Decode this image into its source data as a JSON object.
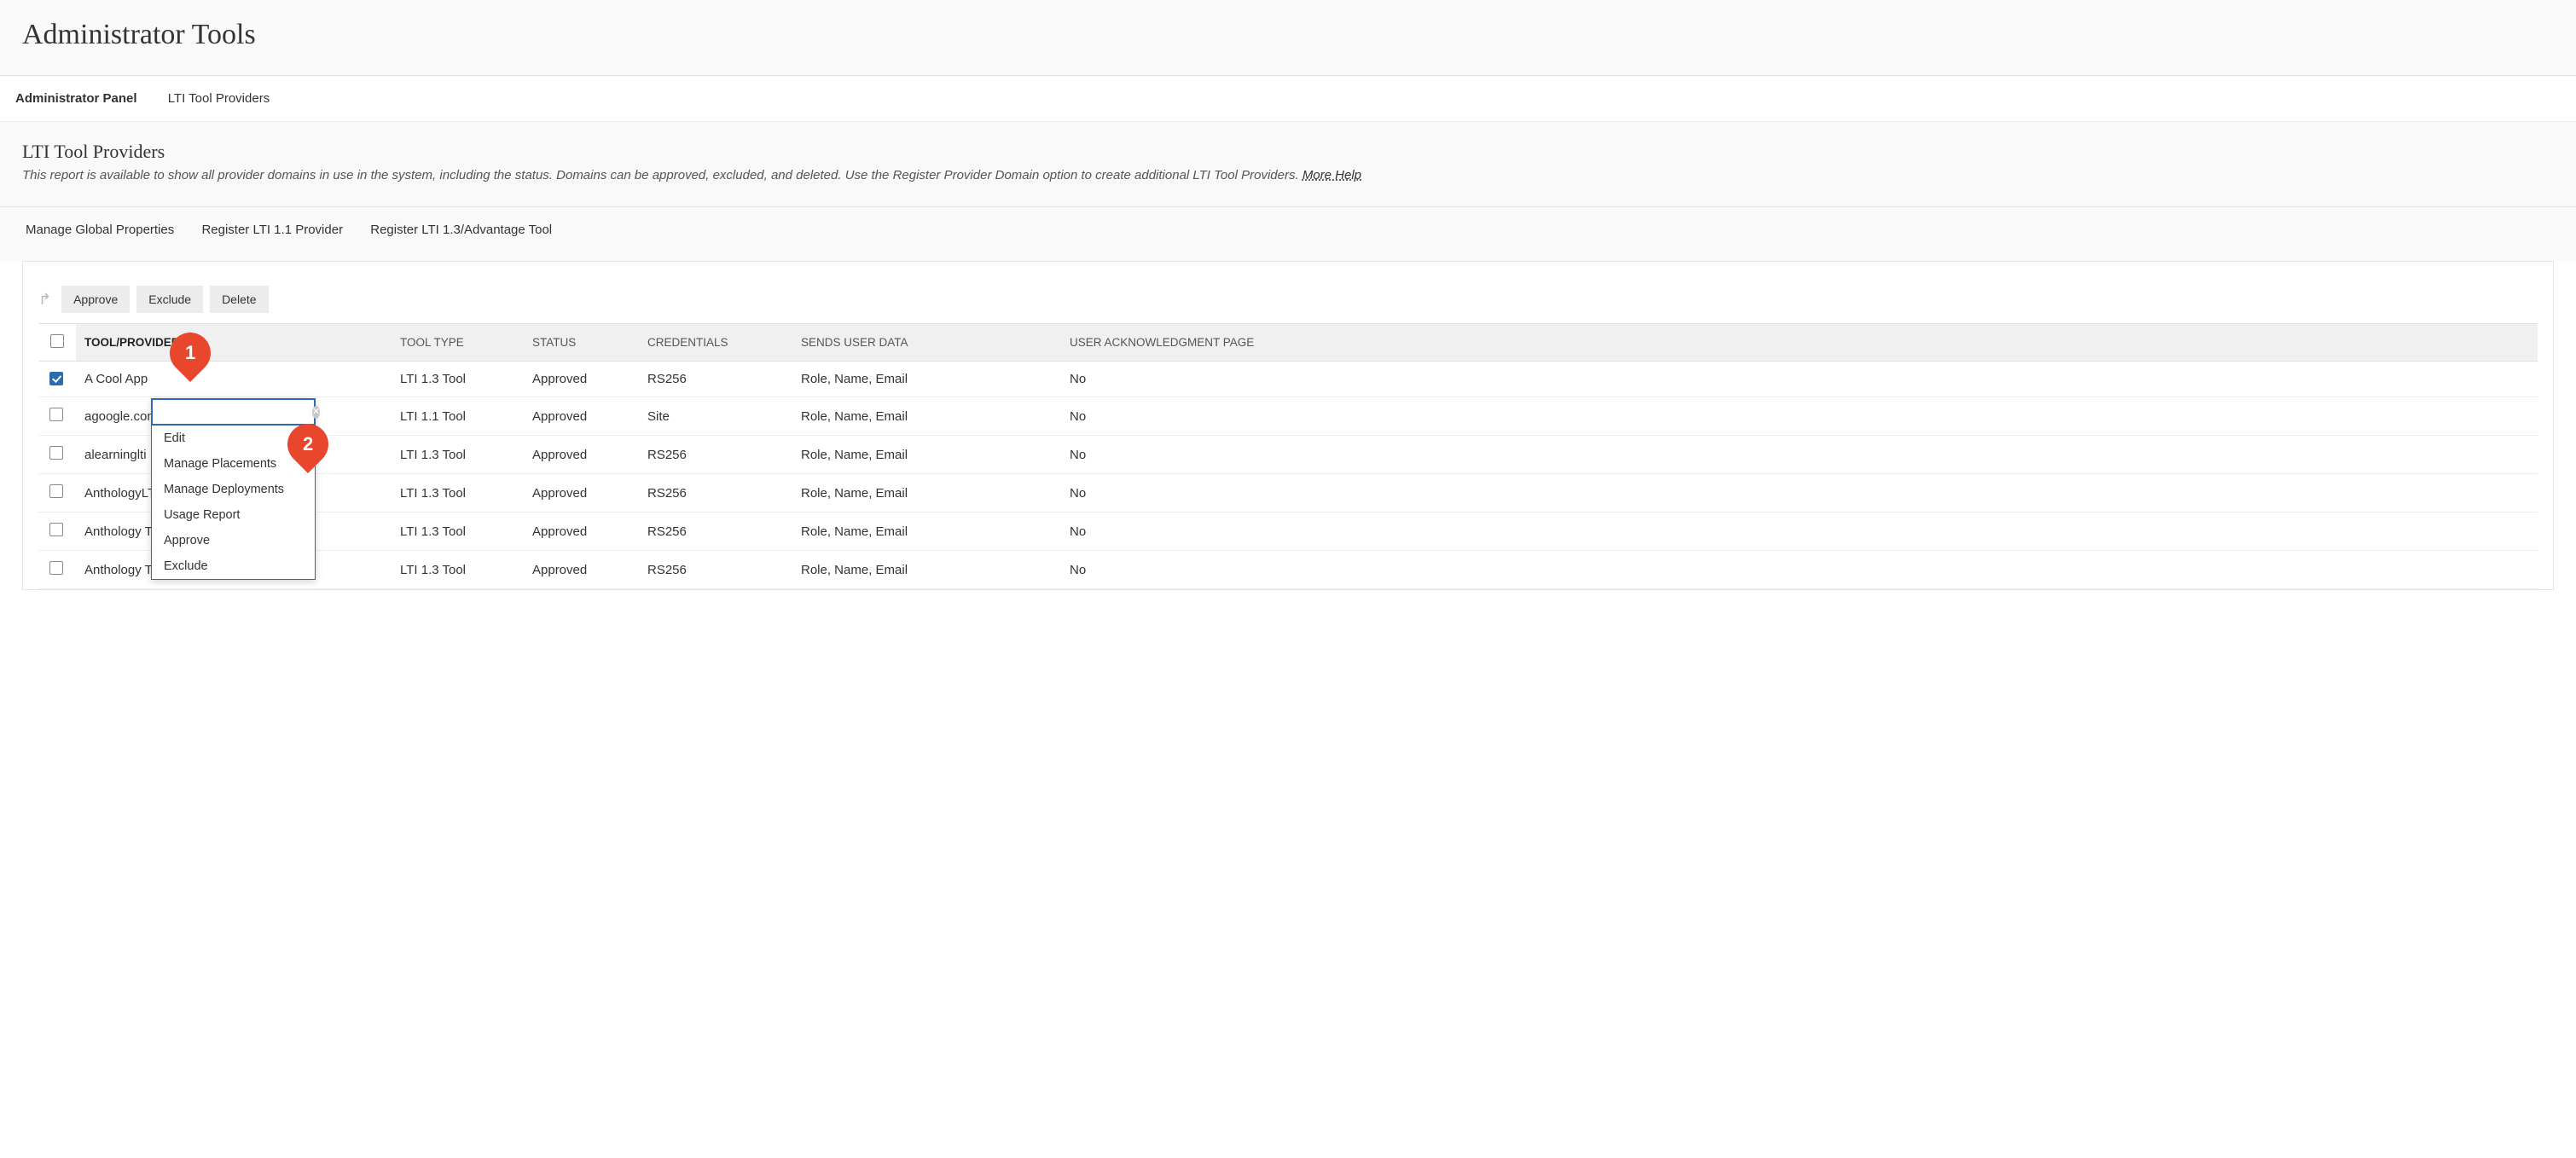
{
  "page": {
    "title": "Administrator Tools"
  },
  "breadcrumb": {
    "items": [
      {
        "label": "Administrator Panel",
        "bold": true
      },
      {
        "label": "LTI Tool Providers",
        "bold": false
      }
    ]
  },
  "section": {
    "title": "LTI Tool Providers",
    "description": "This report is available to show all provider domains in use in the system, including the status. Domains can be approved, excluded, and deleted. Use the Register Provider Domain option to create additional LTI Tool Providers.",
    "more_help": "More Help"
  },
  "subnav": {
    "items": [
      {
        "label": "Manage Global Properties"
      },
      {
        "label": "Register LTI 1.1 Provider"
      },
      {
        "label": "Register LTI 1.3/Advantage Tool"
      }
    ]
  },
  "actions": {
    "approve": "Approve",
    "exclude": "Exclude",
    "delete": "Delete"
  },
  "columns": {
    "tool": "TOOL/PROVIDER",
    "type": "TOOL TYPE",
    "status": "STATUS",
    "credentials": "CREDENTIALS",
    "sends": "SENDS USER DATA",
    "ack": "USER ACKNOWLEDGMENT PAGE"
  },
  "rows": [
    {
      "checked": true,
      "name": "A Cool App",
      "link": false,
      "type": "LTI 1.3 Tool",
      "status": "Approved",
      "credentials": "RS256",
      "sends": "Role, Name, Email",
      "ack": "No"
    },
    {
      "checked": false,
      "name": "agoogle.com",
      "link": true,
      "type": "LTI 1.1 Tool",
      "status": "Approved",
      "credentials": "Site",
      "sends": "Role, Name, Email",
      "ack": "No"
    },
    {
      "checked": false,
      "name": "alearninglti",
      "link": false,
      "type": "LTI 1.3 Tool",
      "status": "Approved",
      "credentials": "RS256",
      "sends": "Role, Name, Email",
      "ack": "No"
    },
    {
      "checked": false,
      "name": "AnthologyLT",
      "link": false,
      "type": "LTI 1.3 Tool",
      "status": "Approved",
      "credentials": "RS256",
      "sends": "Role, Name, Email",
      "ack": "No"
    },
    {
      "checked": false,
      "name": "Anthology T",
      "link": false,
      "type": "LTI 1.3 Tool",
      "status": "Approved",
      "credentials": "RS256",
      "sends": "Role, Name, Email",
      "ack": "No"
    },
    {
      "checked": false,
      "name": "Anthology T",
      "link": false,
      "type": "LTI 1.3 Tool",
      "status": "Approved",
      "credentials": "RS256",
      "sends": "Role, Name, Email",
      "ack": "No"
    }
  ],
  "context_menu": {
    "search_value": "",
    "items": [
      {
        "label": "Edit"
      },
      {
        "label": "Manage Placements"
      },
      {
        "label": "Manage Deployments"
      },
      {
        "label": "Usage Report"
      },
      {
        "label": "Approve"
      },
      {
        "label": "Exclude"
      }
    ]
  },
  "annotations": {
    "one": "1",
    "two": "2"
  }
}
